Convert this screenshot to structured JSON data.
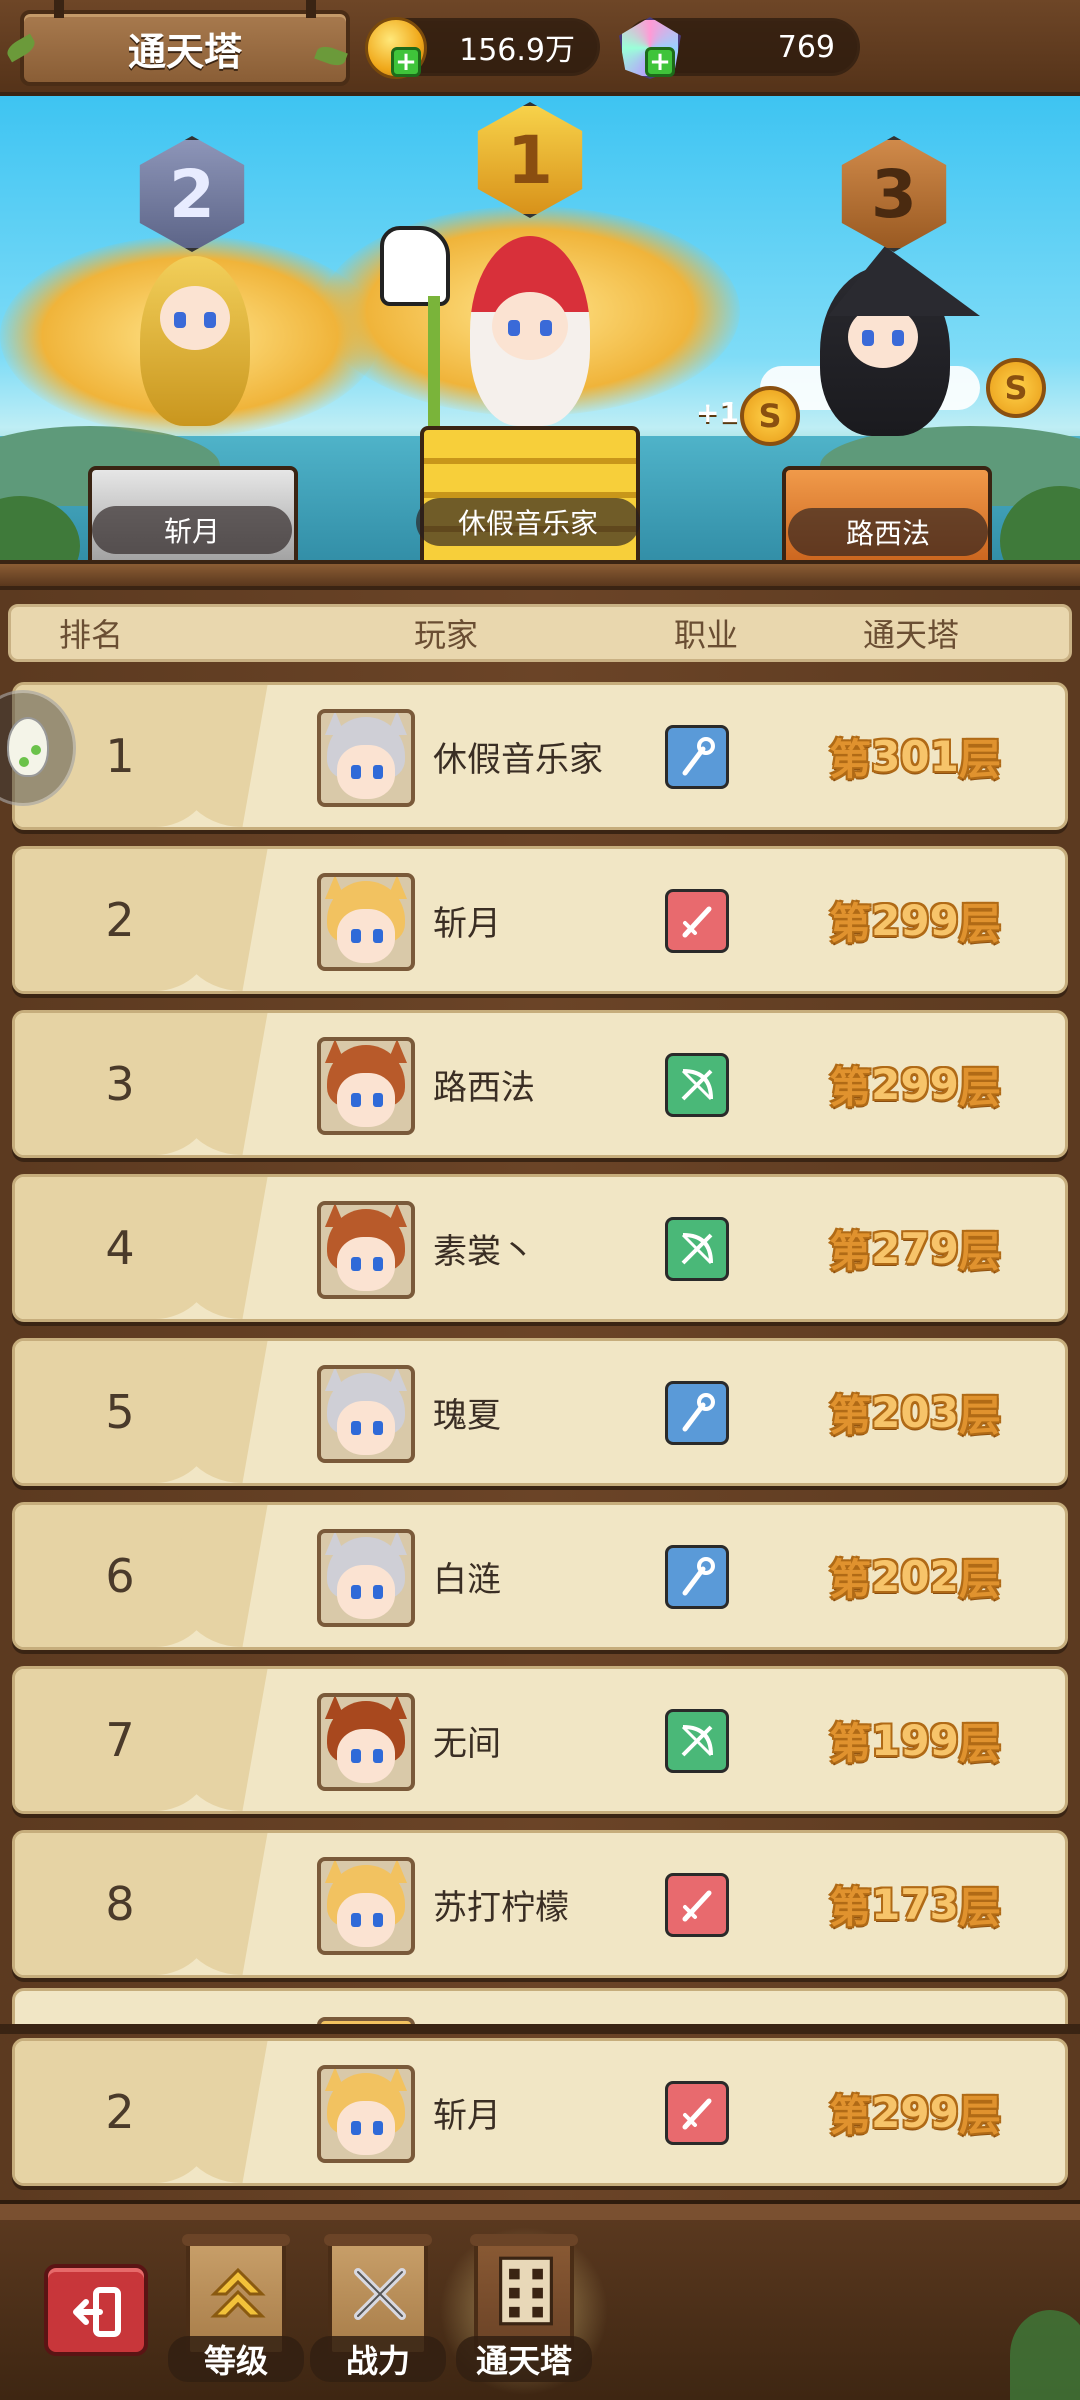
{
  "header": {
    "title": "通天塔",
    "gold_value": "156.9万",
    "gem_value": "769"
  },
  "podium": {
    "first": {
      "rank": "1",
      "name": "休假音乐家"
    },
    "second": {
      "rank": "2",
      "name": "斩月"
    },
    "third": {
      "rank": "3",
      "name": "路西法"
    },
    "coin_bonus": "+1"
  },
  "table": {
    "headers": {
      "rank": "排名",
      "player": "玩家",
      "job": "职业",
      "tower": "通天塔"
    },
    "rows": [
      {
        "rank": "1",
        "name": "休假音乐家",
        "job": "mage",
        "floor": "第301层",
        "avatar": "silver"
      },
      {
        "rank": "2",
        "name": "斩月",
        "job": "warrior",
        "floor": "第299层",
        "avatar": "blonde"
      },
      {
        "rank": "3",
        "name": "路西法",
        "job": "archer",
        "floor": "第299层",
        "avatar": "brown"
      },
      {
        "rank": "4",
        "name": "素裳丶",
        "job": "archer",
        "floor": "第279层",
        "avatar": "brown"
      },
      {
        "rank": "5",
        "name": "瑰夏",
        "job": "mage",
        "floor": "第203层",
        "avatar": "silver"
      },
      {
        "rank": "6",
        "name": "白涟",
        "job": "mage",
        "floor": "第202层",
        "avatar": "silver"
      },
      {
        "rank": "7",
        "name": "无间",
        "job": "archer",
        "floor": "第199层",
        "avatar": "auburn"
      },
      {
        "rank": "8",
        "name": "苏打柠檬",
        "job": "warrior",
        "floor": "第173层",
        "avatar": "blonde"
      }
    ],
    "my_row": {
      "rank": "2",
      "name": "斩月",
      "job": "warrior",
      "floor": "第299层",
      "avatar": "blonde"
    }
  },
  "job_colors": {
    "mage": "#5a9ad8",
    "warrior": "#e86a6e",
    "archer": "#4ab878"
  },
  "avatar_colors": {
    "silver": "#cfcfd6",
    "blonde": "#f2c260",
    "brown": "#b85a2a",
    "auburn": "#a8481e"
  },
  "nav": {
    "items": [
      {
        "label": "等级",
        "icon": "level-up-icon"
      },
      {
        "label": "战力",
        "icon": "crossed-swords-icon"
      },
      {
        "label": "通天塔",
        "icon": "tower-icon"
      }
    ],
    "active": "通天塔"
  }
}
